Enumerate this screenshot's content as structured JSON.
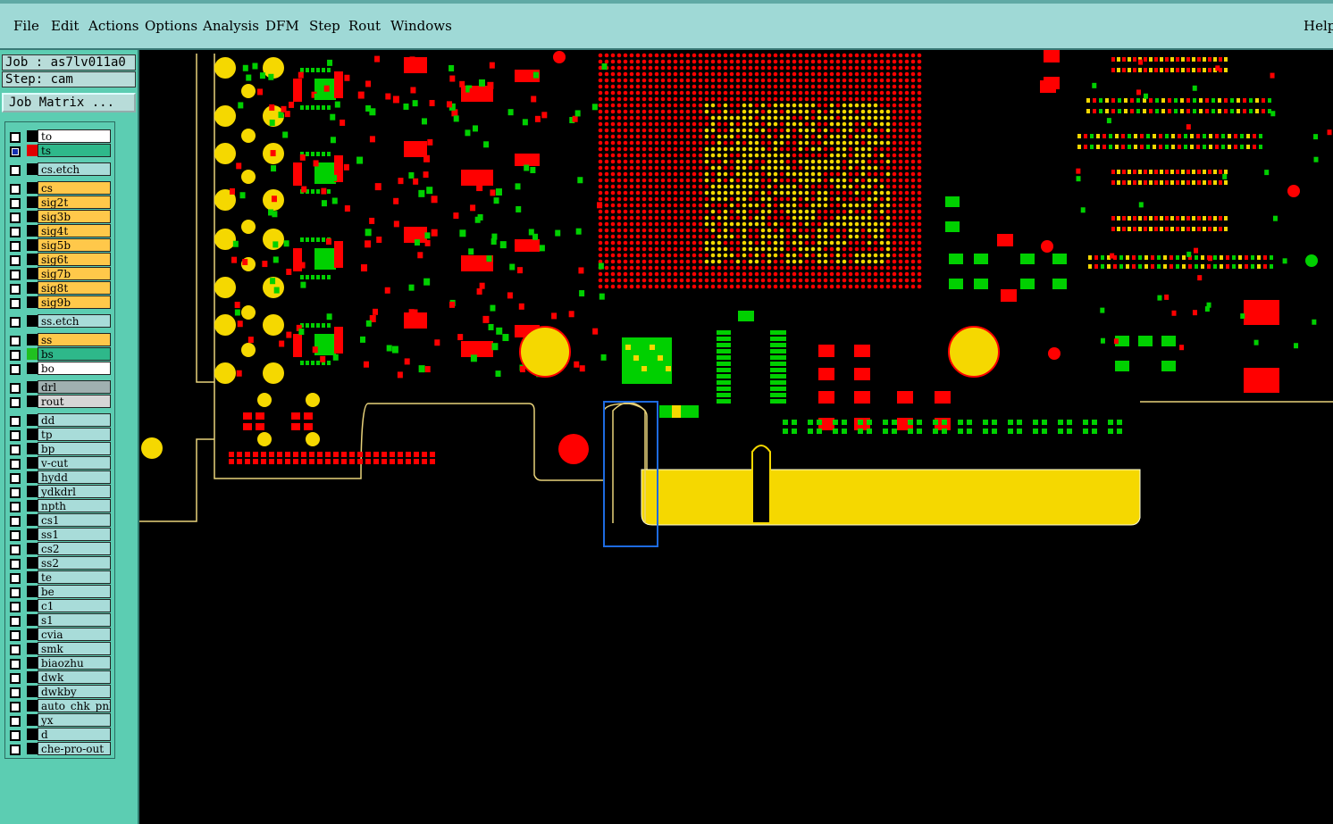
{
  "menu": {
    "file": "File",
    "edit": "Edit",
    "actions": "Actions",
    "options": "Options",
    "analysis": "Analysis",
    "dfm": "DFM",
    "step": "Step",
    "rout": "Rout",
    "windows": "Windows",
    "help": "Help"
  },
  "panel": {
    "job": "Job : as7lv011a0",
    "step": "Step: cam",
    "job_matrix": "Job Matrix ..."
  },
  "layers": [
    {
      "name": "to",
      "color": "#ffffff",
      "swatch": "#000000",
      "active": false
    },
    {
      "name": "ts",
      "color": "#2eb88a",
      "swatch": "#e00000",
      "active": true
    },
    {
      "name": "cs.etch",
      "color": "#a8dcd9",
      "swatch": "#000000",
      "active": false
    },
    {
      "name": "cs",
      "color": "#ffc84a",
      "swatch": "#000000",
      "active": false
    },
    {
      "name": "sig2t",
      "color": "#ffc84a",
      "swatch": "#000000",
      "active": false
    },
    {
      "name": "sig3b",
      "color": "#ffc84a",
      "swatch": "#000000",
      "active": false
    },
    {
      "name": "sig4t",
      "color": "#ffc84a",
      "swatch": "#000000",
      "active": false
    },
    {
      "name": "sig5b",
      "color": "#ffc84a",
      "swatch": "#000000",
      "active": false
    },
    {
      "name": "sig6t",
      "color": "#ffc84a",
      "swatch": "#000000",
      "active": false
    },
    {
      "name": "sig7b",
      "color": "#ffc84a",
      "swatch": "#000000",
      "active": false
    },
    {
      "name": "sig8t",
      "color": "#ffc84a",
      "swatch": "#000000",
      "active": false
    },
    {
      "name": "sig9b",
      "color": "#ffc84a",
      "swatch": "#000000",
      "active": false
    },
    {
      "name": "ss.etch",
      "color": "#a8dcd9",
      "swatch": "#000000",
      "active": false
    },
    {
      "name": "ss",
      "color": "#ffc84a",
      "swatch": "#000000",
      "active": false
    },
    {
      "name": "bs",
      "color": "#2eb88a",
      "swatch": "#20c020",
      "active": false
    },
    {
      "name": "bo",
      "color": "#ffffff",
      "swatch": "#000000",
      "active": false
    },
    {
      "name": "drl",
      "color": "#a0b0b0",
      "swatch": "#000000",
      "active": false
    },
    {
      "name": "rout",
      "color": "#d6d6d6",
      "swatch": "#000000",
      "active": false
    },
    {
      "name": "dd",
      "color": "#a8dcd9",
      "swatch": "#000000",
      "active": false
    },
    {
      "name": "tp",
      "color": "#a8dcd9",
      "swatch": "#000000",
      "active": false
    },
    {
      "name": "bp",
      "color": "#a8dcd9",
      "swatch": "#000000",
      "active": false
    },
    {
      "name": "v-cut",
      "color": "#a8dcd9",
      "swatch": "#000000",
      "active": false
    },
    {
      "name": "hydd",
      "color": "#a8dcd9",
      "swatch": "#000000",
      "active": false
    },
    {
      "name": "ydkdrl",
      "color": "#a8dcd9",
      "swatch": "#000000",
      "active": false
    },
    {
      "name": "npth",
      "color": "#a8dcd9",
      "swatch": "#000000",
      "active": false
    },
    {
      "name": "cs1",
      "color": "#a8dcd9",
      "swatch": "#000000",
      "active": false
    },
    {
      "name": "ss1",
      "color": "#a8dcd9",
      "swatch": "#000000",
      "active": false
    },
    {
      "name": "cs2",
      "color": "#a8dcd9",
      "swatch": "#000000",
      "active": false
    },
    {
      "name": "ss2",
      "color": "#a8dcd9",
      "swatch": "#000000",
      "active": false
    },
    {
      "name": "te",
      "color": "#a8dcd9",
      "swatch": "#000000",
      "active": false
    },
    {
      "name": "be",
      "color": "#a8dcd9",
      "swatch": "#000000",
      "active": false
    },
    {
      "name": "c1",
      "color": "#a8dcd9",
      "swatch": "#000000",
      "active": false
    },
    {
      "name": "s1",
      "color": "#a8dcd9",
      "swatch": "#000000",
      "active": false
    },
    {
      "name": "cvia",
      "color": "#a8dcd9",
      "swatch": "#000000",
      "active": false
    },
    {
      "name": "smk",
      "color": "#a8dcd9",
      "swatch": "#000000",
      "active": false
    },
    {
      "name": "biaozhu",
      "color": "#a8dcd9",
      "swatch": "#000000",
      "active": false
    },
    {
      "name": "dwk",
      "color": "#a8dcd9",
      "swatch": "#000000",
      "active": false
    },
    {
      "name": "dwkby",
      "color": "#a8dcd9",
      "swatch": "#000000",
      "active": false
    },
    {
      "name": "auto_chk_pnl",
      "color": "#a8dcd9",
      "swatch": "#000000",
      "active": false
    },
    {
      "name": "yx",
      "color": "#a8dcd9",
      "swatch": "#000000",
      "active": false
    },
    {
      "name": "d",
      "color": "#a8dcd9",
      "swatch": "#000000",
      "active": false
    },
    {
      "name": "che-pro-out",
      "color": "#a8dcd9",
      "swatch": "#000000",
      "active": false
    }
  ],
  "colors": {
    "copper": "#f5d800",
    "mask_red": "#ff0000",
    "mask_green": "#00d000",
    "selection": "#1e6be0",
    "outline": "#e8d27a"
  }
}
